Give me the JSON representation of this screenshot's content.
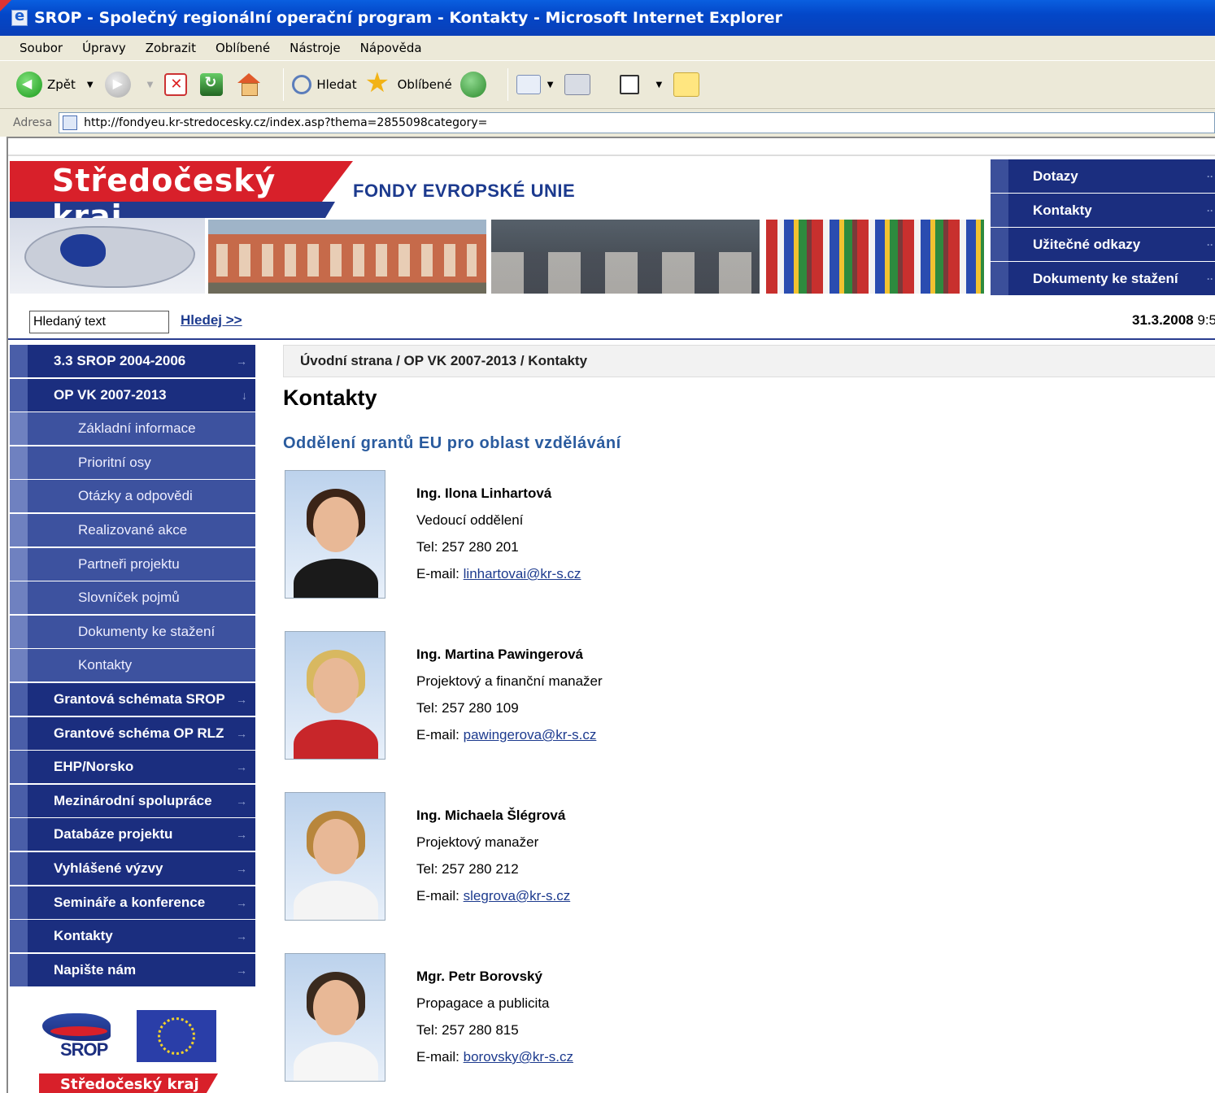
{
  "window": {
    "title": "SROP - Společný regionální operační program - Kontakty - Microsoft Internet Explorer"
  },
  "menu": [
    "Soubor",
    "Úpravy",
    "Zobrazit",
    "Oblíbené",
    "Nástroje",
    "Nápověda"
  ],
  "toolbar": {
    "back_label": "Zpět",
    "search_label": "Hledat",
    "favorites_label": "Oblíbené"
  },
  "address": {
    "label": "Adresa",
    "url": "http://fondyeu.kr-stredocesky.cz/index.asp?thema=2855098category="
  },
  "header": {
    "logo_text": "Středočeský kraj",
    "subtitle": "FONDY EVROPSKÉ UNIE",
    "top_nav": [
      "Dotazy",
      "Kontakty",
      "Užitečné odkazy",
      "Dokumenty ke stažení"
    ]
  },
  "search": {
    "placeholder": "Hledaný text",
    "button": "Hledej >>",
    "date": "31.3.2008",
    "time": "9:5"
  },
  "sidebar": [
    {
      "label": "3.3 SROP 2004-2006",
      "arrow": "→",
      "sub": false
    },
    {
      "label": "OP VK 2007-2013",
      "arrow": "↓",
      "sub": false
    },
    {
      "label": "Základní informace",
      "arrow": "",
      "sub": true
    },
    {
      "label": "Prioritní osy",
      "arrow": "",
      "sub": true
    },
    {
      "label": "Otázky a odpovědi",
      "arrow": "",
      "sub": true
    },
    {
      "label": "Realizované akce",
      "arrow": "",
      "sub": true
    },
    {
      "label": "Partneři projektu",
      "arrow": "",
      "sub": true
    },
    {
      "label": "Slovníček pojmů",
      "arrow": "",
      "sub": true
    },
    {
      "label": "Dokumenty ke stažení",
      "arrow": "",
      "sub": true
    },
    {
      "label": "Kontakty",
      "arrow": "",
      "sub": true
    },
    {
      "label": "Grantová schémata SROP",
      "arrow": "→",
      "sub": false
    },
    {
      "label": "Grantové schéma OP RLZ",
      "arrow": "→",
      "sub": false
    },
    {
      "label": "EHP/Norsko",
      "arrow": "→",
      "sub": false
    },
    {
      "label": "Mezinárodní spolupráce",
      "arrow": "→",
      "sub": false
    },
    {
      "label": "Databáze projektu",
      "arrow": "→",
      "sub": false
    },
    {
      "label": "Vyhlášené výzvy",
      "arrow": "→",
      "sub": false
    },
    {
      "label": "Semináře a konference",
      "arrow": "→",
      "sub": false
    },
    {
      "label": "Kontakty",
      "arrow": "→",
      "sub": false
    },
    {
      "label": "Napište nám",
      "arrow": "→",
      "sub": false
    }
  ],
  "logos": {
    "srop": "SROP",
    "bottom": "Středočeský kraj"
  },
  "breadcrumb": "Úvodní strana / OP VK 2007-2013 / Kontakty",
  "page_title": "Kontakty",
  "section_title": "Oddělení grantů EU pro oblast vzdělávání",
  "contacts": [
    {
      "name": "Ing. Ilona Linhartová",
      "role": "Vedoucí oddělení",
      "tel": "Tel: 257 280 201",
      "email_label": "E-mail:",
      "email": "linhartovai@kr-s.cz"
    },
    {
      "name": "Ing. Martina Pawingerová",
      "role": "Projektový a finanční manažer",
      "tel": "Tel: 257 280 109",
      "email_label": "E-mail:",
      "email": "pawingerova@kr-s.cz"
    },
    {
      "name": "Ing. Michaela Šlégrová",
      "role": "Projektový manažer",
      "tel": "Tel: 257 280 212",
      "email_label": "E-mail:",
      "email": "slegrova@kr-s.cz"
    },
    {
      "name": "Mgr. Petr Borovský",
      "role": "Propagace a publicita",
      "tel": "Tel: 257 280 815",
      "email_label": "E-mail:",
      "email": "borovsky@kr-s.cz"
    }
  ],
  "colors": {
    "nav_blue": "#1b2e7f",
    "brand_red": "#d8202a",
    "link_blue": "#1c3a8e",
    "section_blue": "#2a5b9e"
  }
}
